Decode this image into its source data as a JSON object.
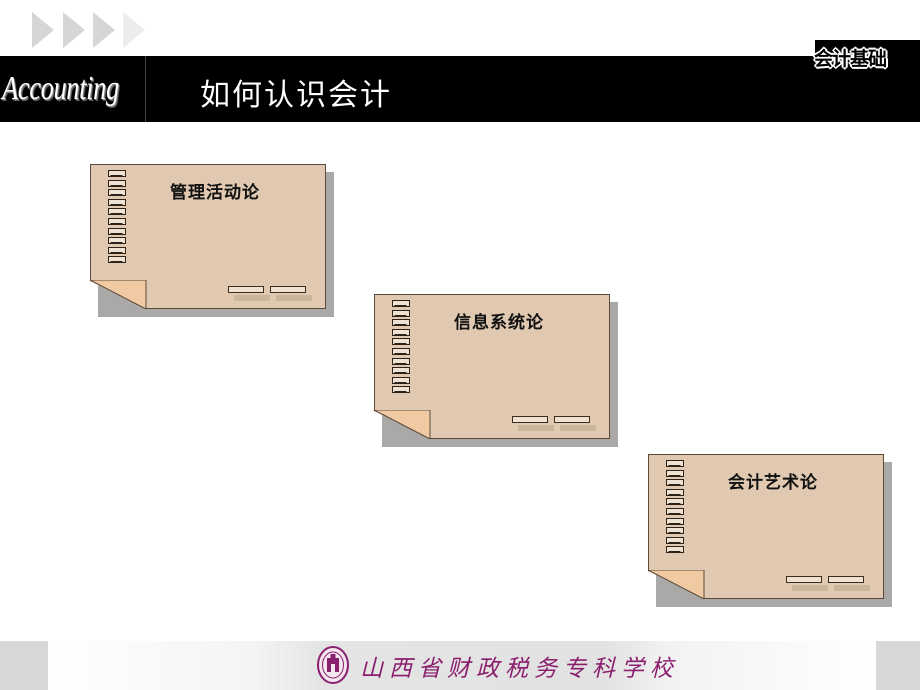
{
  "header": {
    "brand_text": "Accounting",
    "title": "如何认识会计",
    "badge": "会计基础"
  },
  "decorations": {
    "arrow_icon": "play-arrow-icon",
    "arrow_count": 4
  },
  "cards": [
    {
      "title": "管理活动论"
    },
    {
      "title": "信息系统论"
    },
    {
      "title": "会计艺术论"
    }
  ],
  "footer": {
    "school_name": "山西省财政税务专科学校",
    "logo_icon": "school-emblem-icon"
  },
  "colors": {
    "card_paper": "#e0c9b0",
    "card_curl": "#f1c9a2",
    "header_bg": "#000000",
    "footer_text": "#8a1f6e"
  }
}
